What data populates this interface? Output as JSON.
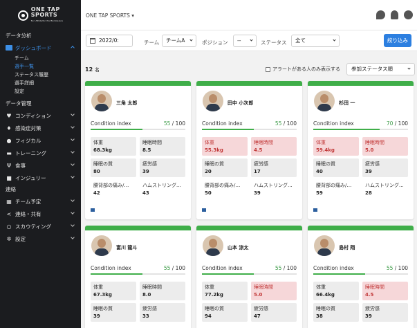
{
  "app": {
    "brand_line1": "ONE TAP",
    "brand_line2": "SPORTS",
    "brand_tagline": "for Athletic Performance",
    "team_selector": "ONE TAP SPORTS ▾"
  },
  "sidebar": {
    "section_analysis": "データ分析",
    "dashboard_label": "ダッシュボード",
    "dashboard_sub": [
      {
        "label": "チーム",
        "selected": false
      },
      {
        "label": "選手一覧",
        "selected": true
      },
      {
        "label": "ステータス履歴",
        "selected": false
      },
      {
        "label": "選手詳細",
        "selected": false
      },
      {
        "label": "設定",
        "selected": false
      }
    ],
    "section_management": "データ管理",
    "items": [
      {
        "icon": "heart-icon",
        "glyph": "♥",
        "label": "コンディション"
      },
      {
        "icon": "shield-icon",
        "glyph": "♦",
        "label": "感染症対策"
      },
      {
        "icon": "person-icon",
        "glyph": "●",
        "label": "フィジカル"
      },
      {
        "icon": "dumbbell-icon",
        "glyph": "▬",
        "label": "トレーニング"
      },
      {
        "icon": "fork-knife-icon",
        "glyph": "Ψ",
        "label": "食事"
      },
      {
        "icon": "injury-icon",
        "glyph": "■",
        "label": "インジュリー"
      }
    ],
    "section_contact": "連絡",
    "contact_items": [
      {
        "icon": "calendar-icon",
        "glyph": "▦",
        "label": "チーム予定"
      },
      {
        "icon": "share-icon",
        "glyph": "<",
        "label": "連絡・共有"
      },
      {
        "icon": "search-icon",
        "glyph": "○",
        "label": "スカウティング"
      },
      {
        "icon": "gear-icon",
        "glyph": "✲",
        "label": "設定"
      }
    ]
  },
  "filters": {
    "date_value": "2022/0:",
    "team_label": "チーム",
    "team_value": "チームA",
    "position_label": "ポジション",
    "position_value": "--",
    "status_label": "ステータス",
    "status_value": "全て",
    "refine_button": "絞り込み"
  },
  "list_header": {
    "count_number": "12",
    "count_unit": "名",
    "alert_only_label": "アラートがある人のみ表示する",
    "sort_value": "参加ステータス順"
  },
  "colors": {
    "accent": "#2c7fe0",
    "good": "#3fae49",
    "alert_bg": "#f6d7d9",
    "alert_text": "#c23a3a"
  },
  "condition_label": "Condition index",
  "condition_max": "/ 100",
  "metric_labels": {
    "weight": "体重",
    "sleep_time": "睡眠時間",
    "sleep_quality": "睡眠の質",
    "fatigue": "疲労感",
    "back_pain": "腰背部の痛み/ハリ",
    "hamstring": "ハムストリング..."
  },
  "players": [
    {
      "name": "三角 太郎",
      "ci": "55",
      "ci_fraction": 0.55,
      "weight": "68.3kg",
      "weight_alert": false,
      "sleep_time": "8.5",
      "sleep_alert": false,
      "sleep_quality": "80",
      "fatigue": "39",
      "back_pain": "42",
      "hamstring": "43"
    },
    {
      "name": "田中 小次郎",
      "ci": "55",
      "ci_fraction": 0.55,
      "weight": "55.3kg",
      "weight_alert": true,
      "sleep_time": "4.5",
      "sleep_alert": true,
      "sleep_quality": "20",
      "fatigue": "17",
      "back_pain": "50",
      "hamstring": "39"
    },
    {
      "name": "杉田 一",
      "ci": "70",
      "ci_fraction": 0.7,
      "weight": "59.4kg",
      "weight_alert": true,
      "sleep_time": "5.0",
      "sleep_alert": true,
      "sleep_quality": "40",
      "fatigue": "39",
      "back_pain": "59",
      "hamstring": "28"
    },
    {
      "name": "富川 龍斗",
      "ci": "55",
      "ci_fraction": 0.55,
      "weight": "67.3kg",
      "weight_alert": false,
      "sleep_time": "8.0",
      "sleep_alert": false,
      "sleep_quality": "39",
      "fatigue": "33"
    },
    {
      "name": "山本 涼太",
      "ci": "55",
      "ci_fraction": 0.55,
      "weight": "77.2kg",
      "weight_alert": false,
      "sleep_time": "5.0",
      "sleep_alert": true,
      "sleep_quality": "94",
      "fatigue": "47"
    },
    {
      "name": "島村 翔",
      "ci": "55",
      "ci_fraction": 0.55,
      "weight": "66.4kg",
      "weight_alert": false,
      "sleep_time": "4.5",
      "sleep_alert": true,
      "sleep_quality": "38",
      "fatigue": "39"
    }
  ]
}
